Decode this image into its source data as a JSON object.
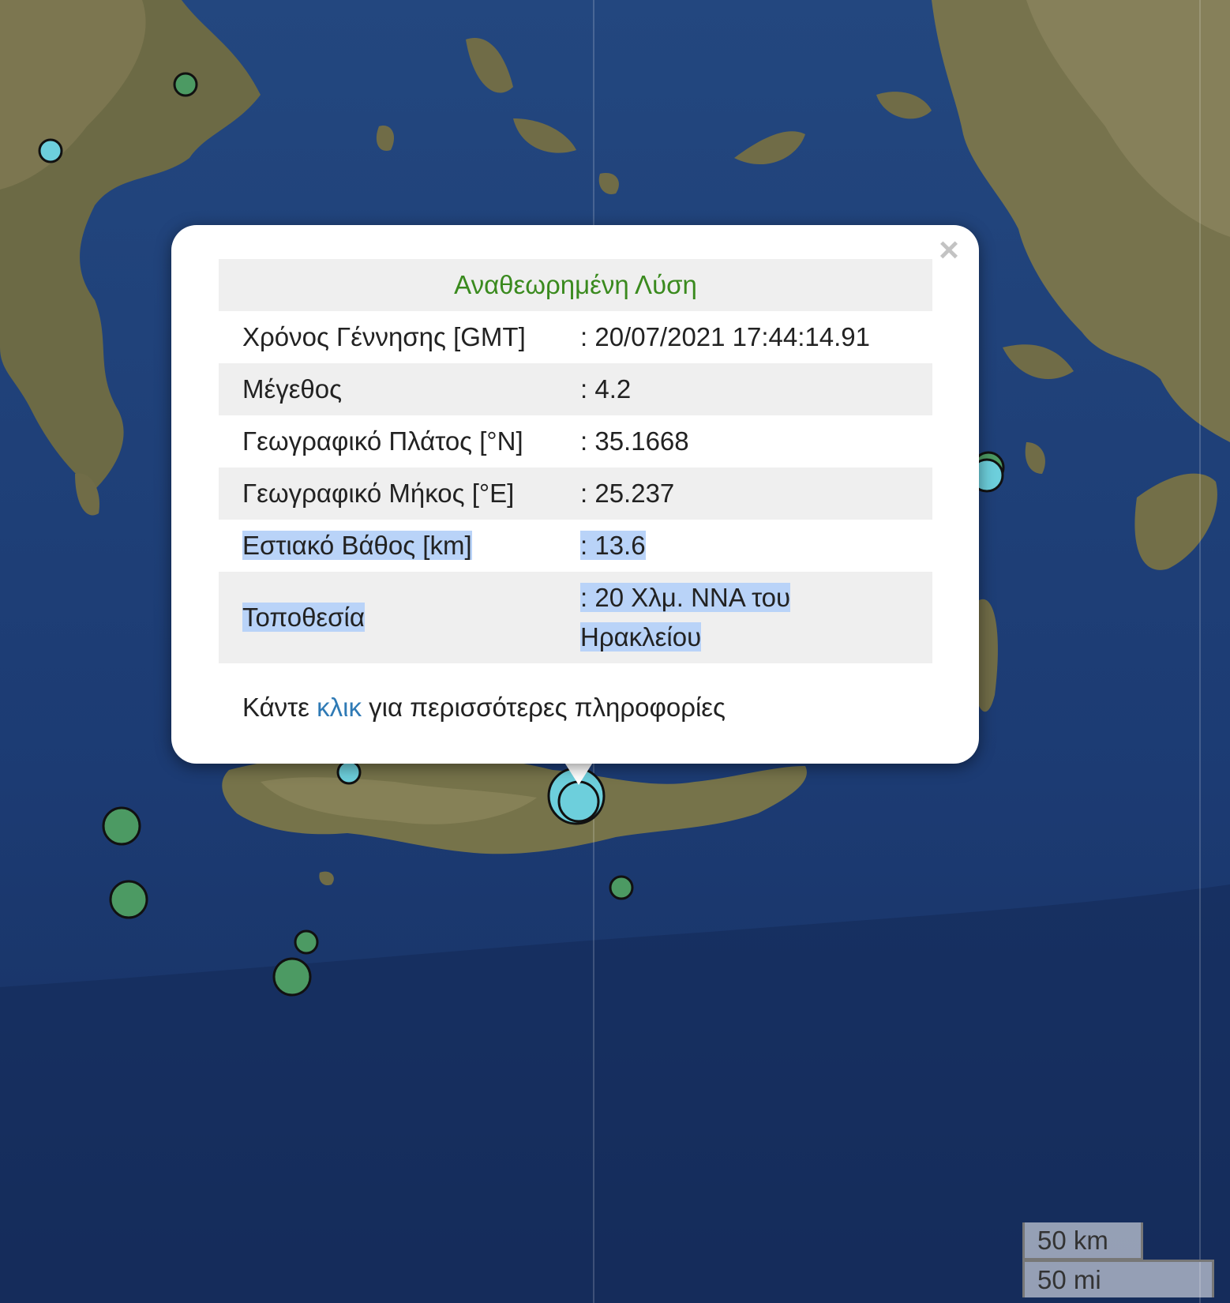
{
  "popup": {
    "title": "Αναθεωρημένη Λύση",
    "close_icon": "close-icon",
    "rows": [
      {
        "label": "Χρόνος Γέννησης [GMT]",
        "value": ": 20/07/2021 17:44:14.91"
      },
      {
        "label": "Μέγεθος",
        "value": ": 4.2"
      },
      {
        "label": "Γεωγραφικό Πλάτος [°N]",
        "value": ": 35.1668"
      },
      {
        "label": "Γεωγραφικό Μήκος [°E]",
        "value": ": 25.237"
      },
      {
        "label": "Εστιακό Βάθος [km]",
        "value": ": 13.6"
      },
      {
        "label": "Τοποθεσία",
        "value": ": 20 Χλμ. ΝΝΑ του Ηρακλείου"
      }
    ],
    "footer": {
      "before": "Κάντε ",
      "link": "κλικ",
      "after": " για περισσότερες πληροφορίες"
    }
  },
  "scale": {
    "km": "50 km",
    "mi": "50 mi"
  },
  "colors": {
    "marker_recent": "#6dcfdc",
    "marker_old": "#4c9a63",
    "title": "#3a8a1e",
    "link": "#2f7ab5"
  }
}
